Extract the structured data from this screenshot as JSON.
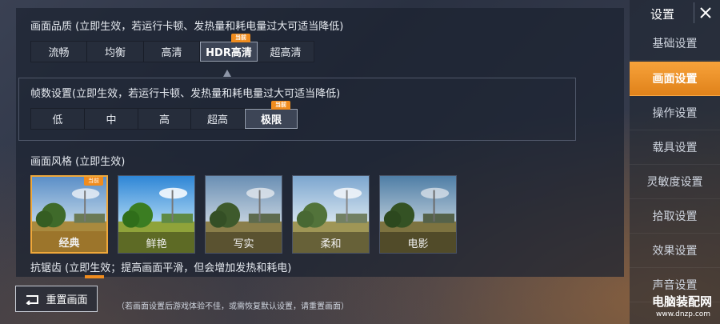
{
  "quality": {
    "title": "画面品质 (立即生效，若运行卡顿、发热量和耗电量过大可适当降低)",
    "options": [
      "流畅",
      "均衡",
      "高清",
      "HDR高清",
      "超高清"
    ],
    "selected": "HDR高清",
    "current_badge": "当前"
  },
  "fps": {
    "title": "帧数设置(立即生效，若运行卡顿、发热量和耗电量过大可适当降低)",
    "options": [
      "低",
      "中",
      "高",
      "超高",
      "极限"
    ],
    "selected": "极限",
    "current_badge": "当前"
  },
  "style": {
    "title": "画面风格 (立即生效)",
    "options": [
      "经典",
      "鲜艳",
      "写实",
      "柔和",
      "电影"
    ],
    "selected": "经典",
    "current_badge": "当前"
  },
  "antialias": {
    "title": "抗锯齿 (立即生效；提高画面平滑，但会增加发热和耗电)"
  },
  "footer": {
    "reset_label": "重置画面",
    "hint": "（若画面设置后游戏体验不佳，或需恢复默认设置，请重置画面）"
  },
  "sidebar": {
    "title": "设置",
    "items": [
      "基础设置",
      "画面设置",
      "操作设置",
      "载具设置",
      "灵敏度设置",
      "拾取设置",
      "效果设置",
      "声音设置"
    ],
    "active": "画面设置"
  },
  "watermark": {
    "name": "电脑装配网",
    "url": "www.dnzp.com"
  },
  "colors": {
    "accent": "#f08c1e",
    "panel": "#262d3b"
  }
}
